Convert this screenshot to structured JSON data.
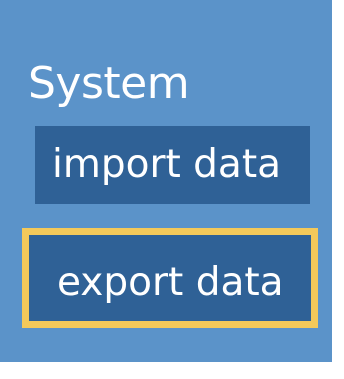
{
  "system_menu": {
    "title": "System",
    "items": [
      {
        "label": "import data",
        "highlighted": false
      },
      {
        "label": "export data",
        "highlighted": true
      }
    ]
  },
  "colors": {
    "panel_background": "#5b93c9",
    "button_background": "#2f6196",
    "highlight_border": "#f4c95a",
    "text": "#ffffff"
  }
}
